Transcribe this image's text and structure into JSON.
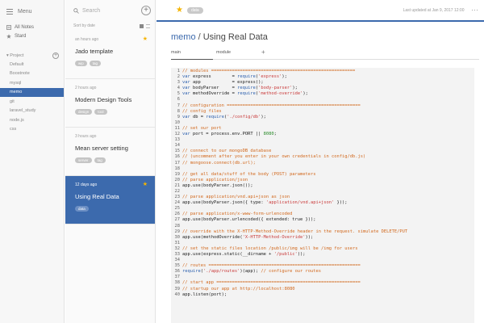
{
  "sidebar": {
    "menu_label": "Menu",
    "items": [
      {
        "label": "All Notes",
        "icon": "notes-icon"
      },
      {
        "label": "Stard",
        "icon": "star-icon"
      }
    ],
    "project_label": "Project",
    "folders": [
      "Default",
      "Boostnote",
      "mysql",
      "memo",
      "git",
      "laravel_study",
      "node.js",
      "css"
    ],
    "active_folder": "memo"
  },
  "notelist": {
    "search_placeholder": "Search",
    "sort_label": "Sort by date",
    "notes": [
      {
        "time": "an hours ago",
        "title": "Jado template",
        "tags": [
          "wip",
          "tag"
        ],
        "starred": true,
        "active": false
      },
      {
        "time": "2 hours ago",
        "title": "Modern Design Tools",
        "tags": [
          "design",
          "tool"
        ],
        "starred": false,
        "active": false
      },
      {
        "time": "3 hours ago",
        "title": "Mean server setting",
        "tags": [
          "server",
          "tag"
        ],
        "starred": false,
        "active": false
      },
      {
        "time": "12 days ago",
        "title": "Using Real Data",
        "tags": [
          "data"
        ],
        "starred": true,
        "active": true
      }
    ]
  },
  "topbar": {
    "tag": "data",
    "updated": "Last updated at  Jan 9, 2017 12:00"
  },
  "header": {
    "folder": "memo",
    "separator": " / ",
    "title": "Using Real Data"
  },
  "tabs": [
    "main",
    "module"
  ],
  "tab_add": "+",
  "accent_color": "#3c6aad",
  "star_color": "#f5b400",
  "code_lines": [
    "// modules =======================================================",
    "var express        = require('express');",
    "var app            = express();",
    "var bodyParser     = require('body-parser');",
    "var methodOverride = require('method-override');",
    "",
    "// configuration ===================================================",
    "// config files",
    "var db = require('./config/db');",
    "",
    "// set our port",
    "var port = process.env.PORT || 8080;",
    "",
    "",
    "// connect to our mongoDB database",
    "// (uncomment after you enter in your own credentials in config/db.js)",
    "// mongoose.connect(db.url);",
    "",
    "// get all data/stuff of the body (POST) parameters",
    "// parse application/json",
    "app.use(bodyParser.json());",
    "",
    "// parse application/vnd.api+json as json",
    "app.use(bodyParser.json({ type: 'application/vnd.api+json' }));",
    "",
    "// parse application/x-www-form-urlencoded",
    "app.use(bodyParser.urlencoded({ extended: true }));",
    "",
    "// override with the X-HTTP-Method-Override header in the request. simulate DELETE/PUT",
    "app.use(methodOverride('X-HTTP-Method-Override'));",
    "",
    "// set the static files location /public/img will be /img for users",
    "app.use(express.static(__dirname + '/public'));",
    "",
    "// routes ==========================================================",
    "require('./app/routes')(app); // configure our routes",
    "",
    "// start app =======================================================",
    "// startup our app at http://localhost:8080",
    "app.listen(port);"
  ]
}
